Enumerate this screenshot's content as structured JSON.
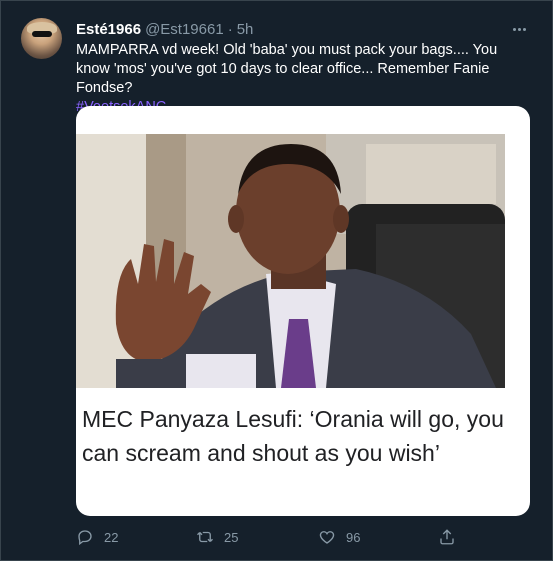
{
  "tweet": {
    "display_name": "Esté1966",
    "handle": "@Est19661",
    "separator": "·",
    "time": "5h",
    "text": "MAMPARRA vd week! Old 'baba' you must pack your bags.... You know 'mos' you've got 10 days to clear office... Remember Fanie Fondse?",
    "hashtag": "#VoetsekANC",
    "more_icon": "ellipsis-icon"
  },
  "card": {
    "headline": "MEC Panyaza Lesufi: ‘Orania will go, you can scream and shout as you wish’"
  },
  "actions": {
    "reply_count": "22",
    "retweet_count": "25",
    "like_count": "96"
  },
  "colors": {
    "background": "#15202b",
    "muted": "#8899a6",
    "hashtag": "#8a63ff"
  }
}
